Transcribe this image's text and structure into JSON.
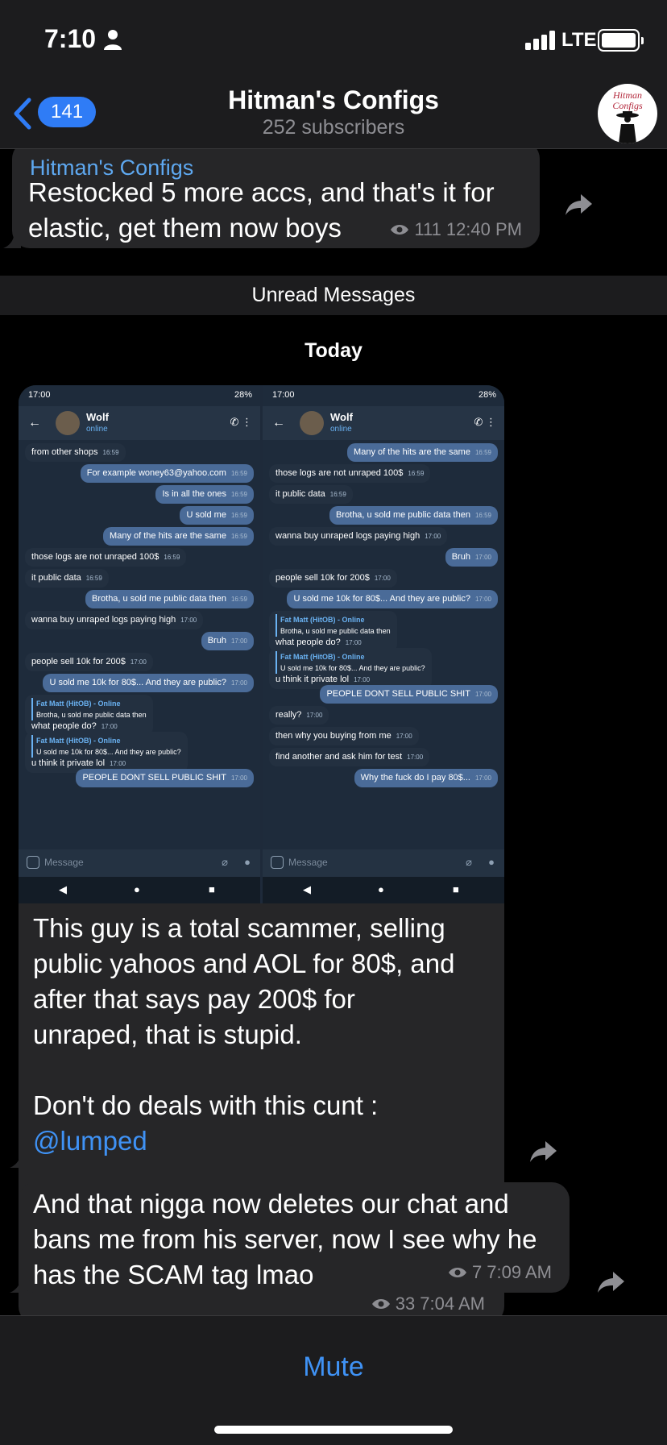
{
  "status": {
    "time": "7:10",
    "network": "LTE"
  },
  "header": {
    "back_count": "141",
    "title": "Hitman's Configs",
    "subtitle": "252 subscribers",
    "avatar_text_1": "Hitman",
    "avatar_text_2": "Configs"
  },
  "messages": [
    {
      "sender": "Hitman's Configs",
      "text": "Restocked 5 more accs, and that's it for\nelastic, get them now boys",
      "views": "111",
      "time": "12:40 PM"
    }
  ],
  "unread_label": "Unread Messages",
  "date_label": "Today",
  "screenshot": {
    "left": {
      "time": "17:00",
      "battery": "28%",
      "contact": "Wolf",
      "status": "online",
      "messages": [
        {
          "dir": "in",
          "text": "from other shops",
          "ts": "16:59"
        },
        {
          "dir": "out",
          "text": "For example woney63@yahoo.com",
          "ts": "16:59"
        },
        {
          "dir": "out",
          "text": "Is in all the ones",
          "ts": "16:59"
        },
        {
          "dir": "out",
          "text": "U sold me",
          "ts": "16:59"
        },
        {
          "dir": "out",
          "text": "Many of the hits are the same",
          "ts": "16:59"
        },
        {
          "dir": "in",
          "text": "those logs are not unraped 100$",
          "ts": "16:59"
        },
        {
          "dir": "in",
          "text": "it public data",
          "ts": "16:59"
        },
        {
          "dir": "out",
          "text": "Brotha, u sold me public data then",
          "ts": "16:59"
        },
        {
          "dir": "in",
          "text": "wanna buy unraped logs paying high",
          "ts": "17:00"
        },
        {
          "dir": "out",
          "text": "Bruh",
          "ts": "17:00"
        },
        {
          "dir": "in",
          "text": "people sell 10k for 200$",
          "ts": "17:00"
        },
        {
          "dir": "out",
          "text": "U sold me 10k for 80$... And they are public?",
          "ts": "17:00"
        },
        {
          "dir": "in",
          "quote_name": "Fat Matt (HitOB) - Online",
          "quote_text": "Brotha, u sold me public data then",
          "text": "what people do?",
          "ts": "17:00"
        },
        {
          "dir": "in",
          "quote_name": "Fat Matt (HitOB) - Online",
          "quote_text": "U sold me 10k for 80$... And they are public?",
          "text": "u think it private lol",
          "ts": "17:00"
        },
        {
          "dir": "out",
          "text": "PEOPLE DONT SELL PUBLIC SHIT",
          "ts": "17:00"
        }
      ],
      "input_placeholder": "Message"
    },
    "right": {
      "time": "17:00",
      "battery": "28%",
      "contact": "Wolf",
      "status": "online",
      "messages": [
        {
          "dir": "out",
          "text": "Many of the hits are the same",
          "ts": "16:59"
        },
        {
          "dir": "in",
          "text": "those logs are not unraped 100$",
          "ts": "16:59"
        },
        {
          "dir": "in",
          "text": "it public data",
          "ts": "16:59"
        },
        {
          "dir": "out",
          "text": "Brotha, u sold me public data then",
          "ts": "16:59"
        },
        {
          "dir": "in",
          "text": "wanna buy unraped logs paying high",
          "ts": "17:00"
        },
        {
          "dir": "out",
          "text": "Bruh",
          "ts": "17:00"
        },
        {
          "dir": "in",
          "text": "people sell 10k for 200$",
          "ts": "17:00"
        },
        {
          "dir": "out",
          "text": "U sold me 10k for 80$... And they are public?",
          "ts": "17:00"
        },
        {
          "dir": "in",
          "quote_name": "Fat Matt (HitOB) - Online",
          "quote_text": "Brotha, u sold me public data then",
          "text": "what people do?",
          "ts": "17:00"
        },
        {
          "dir": "in",
          "quote_name": "Fat Matt (HitOB) - Online",
          "quote_text": "U sold me 10k for 80$... And they are public?",
          "text": "u think it private lol",
          "ts": "17:00"
        },
        {
          "dir": "out",
          "text": "PEOPLE DONT SELL PUBLIC SHIT",
          "ts": "17:00"
        },
        {
          "dir": "in",
          "text": "really?",
          "ts": "17:00"
        },
        {
          "dir": "in",
          "text": "then why you buying from me",
          "ts": "17:00"
        },
        {
          "dir": "in",
          "text": "find another and ask him for test",
          "ts": "17:00"
        },
        {
          "dir": "out",
          "text": "Why the fuck do I pay 80$...",
          "ts": "17:00"
        }
      ],
      "input_placeholder": "Message"
    }
  },
  "media_post": {
    "caption": "This guy is a total scammer, selling\npublic yahoos and AOL for 80$, and\nafter that says pay 200$ for\nunraped, that is stupid.\n\nDon't do deals with this cunt :",
    "mention": "@lumped",
    "views": "33",
    "time": "7:04 AM"
  },
  "last_message": {
    "text": "And that nigga now deletes our chat and\nbans me from his server, now I see why he\nhas the SCAM tag lmao",
    "views": "7",
    "time": "7:09 AM"
  },
  "bottom": {
    "mute_label": "Mute"
  },
  "colors": {
    "accent": "#3f92f5",
    "bubble": "#262628",
    "bar": "#1c1c1e"
  }
}
